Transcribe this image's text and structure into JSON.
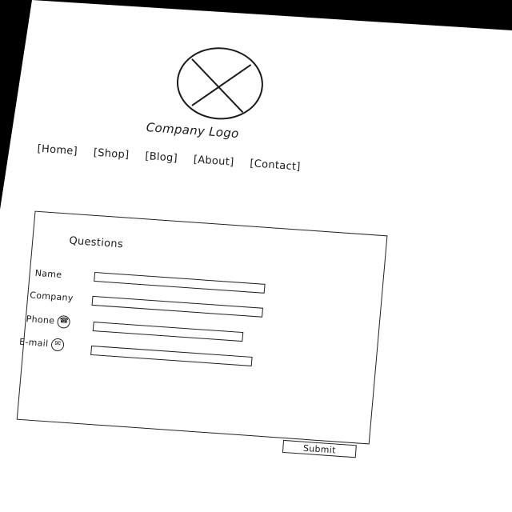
{
  "logo": {
    "icon": "image-placeholder-icon",
    "caption": "Company Logo"
  },
  "nav": {
    "items": [
      {
        "label": "[Home]"
      },
      {
        "label": "[Shop]"
      },
      {
        "label": "[Blog]"
      },
      {
        "label": "[About]"
      },
      {
        "label": "[Contact]"
      }
    ]
  },
  "form": {
    "title": "Questions",
    "fields": [
      {
        "label": "Name",
        "value": ""
      },
      {
        "label": "Company",
        "value": ""
      },
      {
        "label": "Phone",
        "value": "",
        "icon": "phone-icon"
      },
      {
        "label": "E-mail",
        "value": "",
        "icon": "mail-icon"
      }
    ],
    "submit_label": "Submit"
  }
}
